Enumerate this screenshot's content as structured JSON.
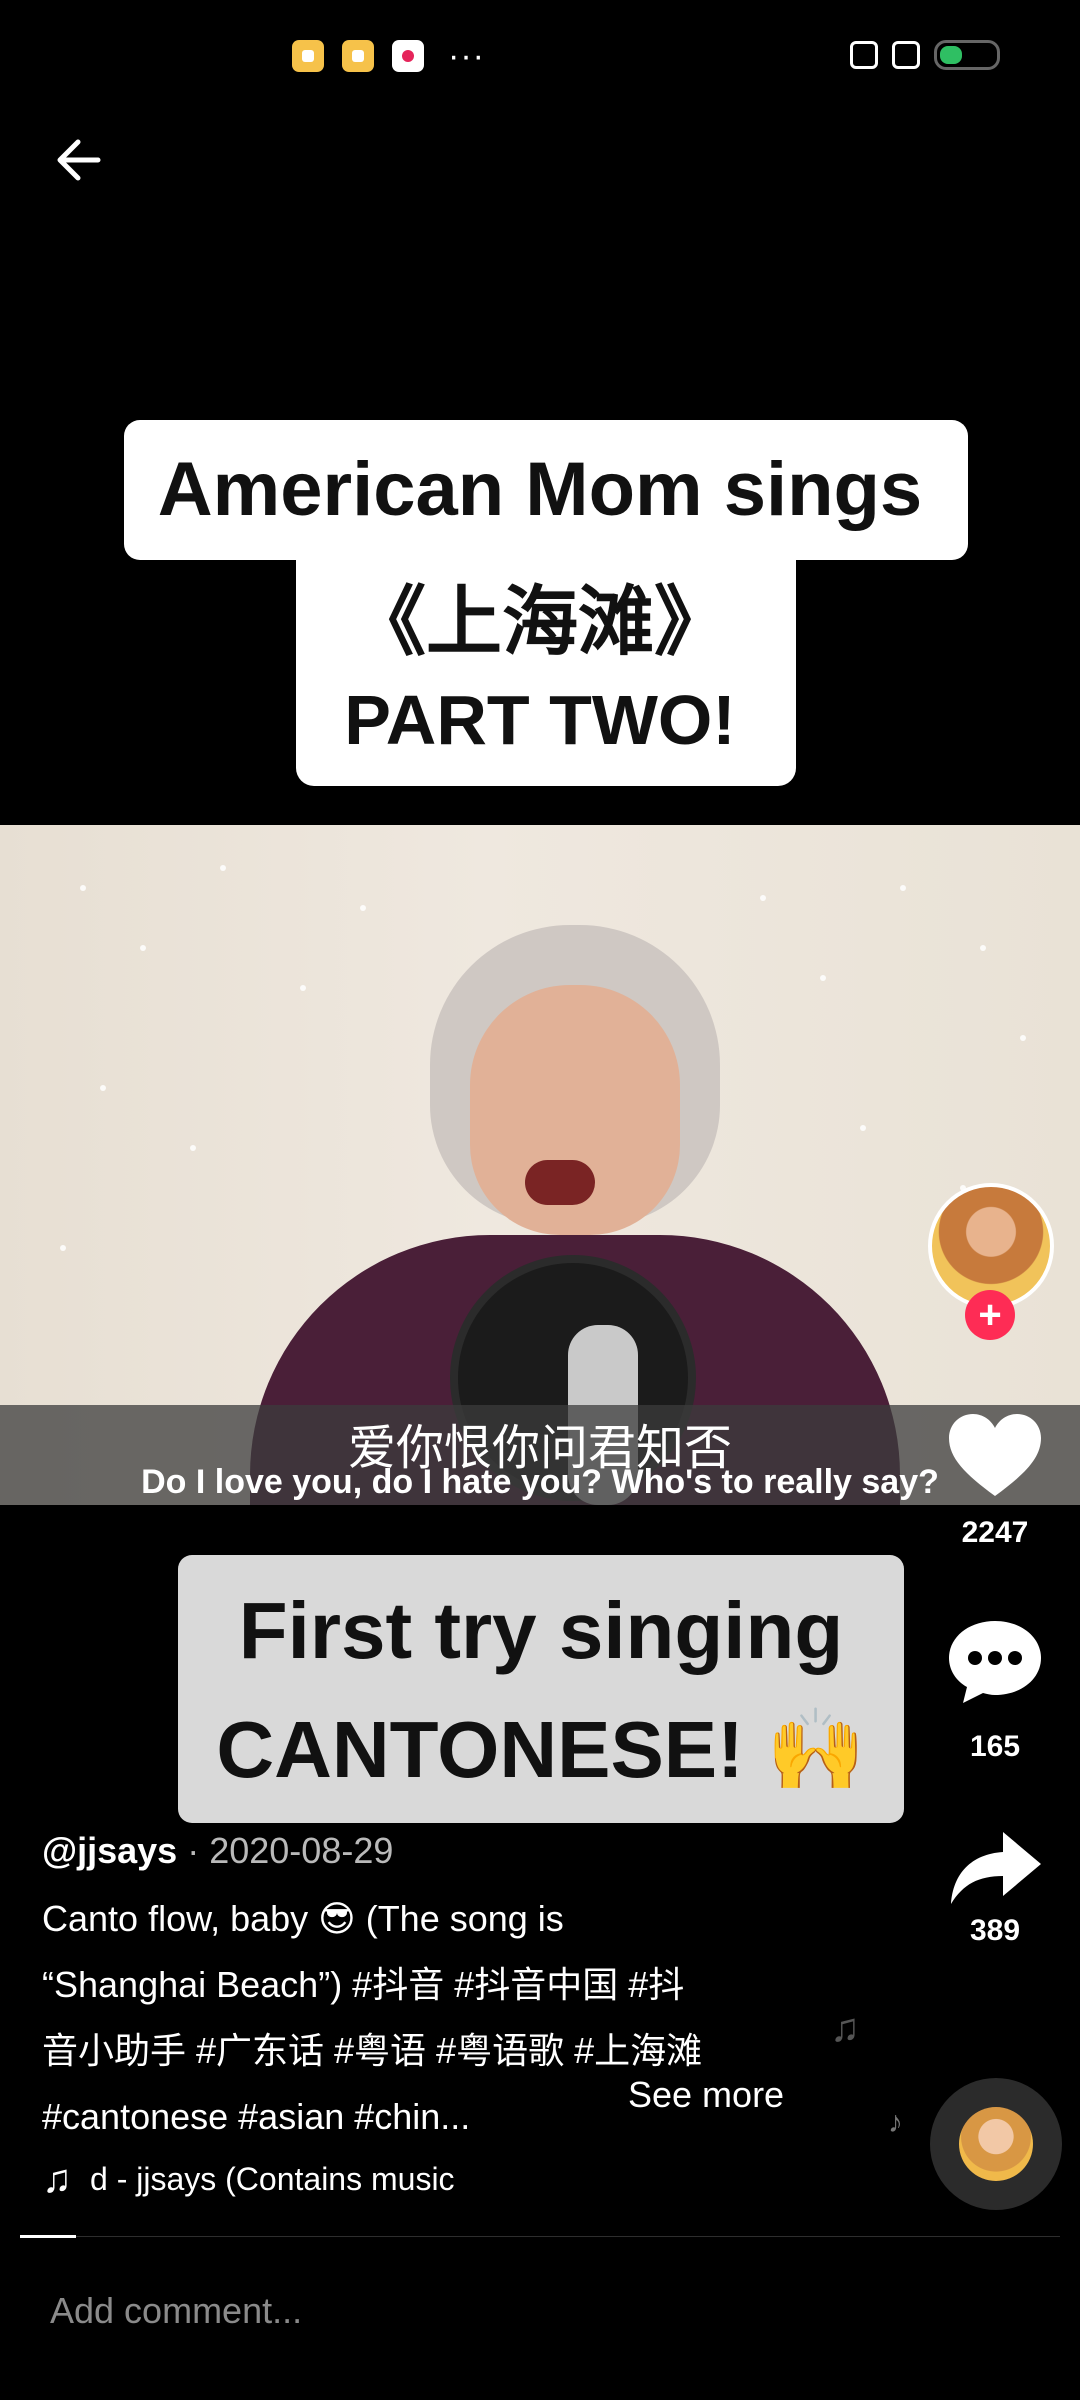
{
  "status_bar": {
    "dots": "···"
  },
  "title_card": {
    "line1": "American Mom sings",
    "line2": "《上海滩》",
    "line3": "PART TWO!"
  },
  "video": {
    "subtitle_cn": "爱你恨你问君知否",
    "subtitle_en": "Do I love you, do I hate you? Who's to really say?"
  },
  "card2": {
    "line1": "First try singing",
    "line2": "CANTONESE! 🙌"
  },
  "rail": {
    "likes": "2247",
    "comments": "165",
    "shares": "389",
    "follow": "+"
  },
  "post": {
    "handle": "@jjsays",
    "date": "2020-08-29",
    "caption_lines": [
      "Canto flow, baby 😎 (The song is",
      "“Shanghai Beach”) #抖音 #抖音中国 #抖",
      "音小助手 #广东话 #粤语 #粤语歌 #上海滩",
      "#cantonese #asian #chin..."
    ],
    "see_more": "See more",
    "music": "d - jjsays (Contains music"
  },
  "comment": {
    "placeholder": "Add comment..."
  },
  "colors": {
    "accent": "#fe2c55",
    "background": "#000000"
  },
  "icons": {
    "back": "arrow-left-icon",
    "like": "heart-icon",
    "comment": "comment-bubble-icon",
    "share": "share-arrow-icon",
    "music": "music-note-icon"
  }
}
